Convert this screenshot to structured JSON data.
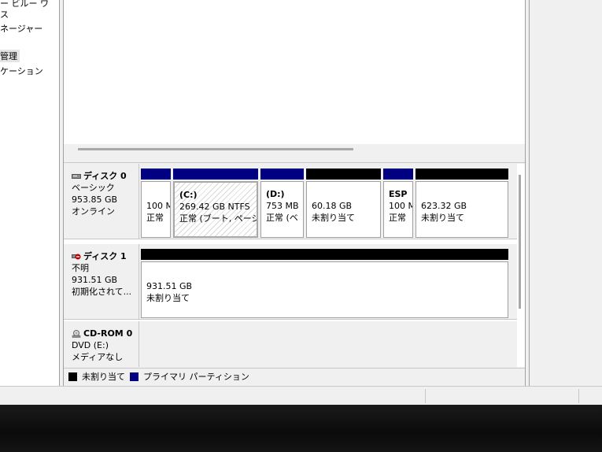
{
  "nav": {
    "items": [
      {
        "label": "ー ビルー ワ",
        "top": 0
      },
      {
        "label": "ス",
        "top": 0
      },
      {
        "label": "ネージャー",
        "top": 0
      },
      {
        "label": "管理",
        "top": 0
      },
      {
        "label": "ケーション",
        "top": 0
      }
    ]
  },
  "disks": [
    {
      "name": "ディスク 0",
      "type": "ベーシック",
      "size": "953.85 GB",
      "state": "オンライン",
      "partitions": [
        {
          "title": "",
          "line1": "100 M",
          "line2": "正常"
        },
        {
          "title": "(C:)",
          "line1": "269.42 GB NTFS",
          "line2": "正常 (ブート, ページ"
        },
        {
          "title": "(D:)",
          "line1": "753 MB",
          "line2": "正常 (ベ"
        },
        {
          "title": "",
          "line1": "60.18 GB",
          "line2": "未割り当て"
        },
        {
          "title": "ESP",
          "line1": "100 M",
          "line2": "正常"
        },
        {
          "title": "",
          "line1": "623.32 GB",
          "line2": "未割り当て"
        }
      ]
    },
    {
      "name": "ディスク 1",
      "type": "不明",
      "size": "931.51 GB",
      "state": "初期化されて...",
      "partitions": [
        {
          "title": "",
          "line1": "931.51 GB",
          "line2": "未割り当て"
        }
      ]
    },
    {
      "name": "CD-ROM 0",
      "type": "DVD (E:)",
      "size": "",
      "state": "メディアなし",
      "partitions": []
    }
  ],
  "legend": {
    "unallocated": "未割り当て",
    "primary": "プライマリ パーティション"
  },
  "colors": {
    "primary": "#000080",
    "unallocated": "#000000"
  }
}
